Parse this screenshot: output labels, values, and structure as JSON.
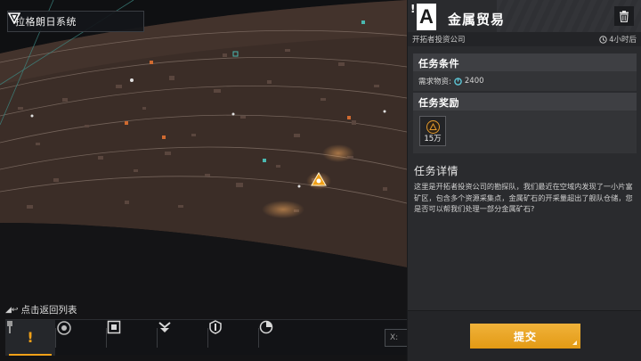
{
  "map": {
    "system_name": "拉格朗日系统",
    "back_label": "点击返回列表",
    "coord_placeholder": "X:"
  },
  "toolbar": {
    "tools": [
      {
        "icon": "mission-alert-icon",
        "active": true
      },
      {
        "icon": "radar-icon",
        "active": false
      },
      {
        "icon": "base-square-icon",
        "active": false
      },
      {
        "icon": "descend-arrow-icon",
        "active": false
      },
      {
        "icon": "shield-marker-icon",
        "active": false
      },
      {
        "icon": "pie-sector-icon",
        "active": false
      }
    ]
  },
  "mission": {
    "alert_mark": "!",
    "rank": "A",
    "title": "金属贸易",
    "issuer": "开拓者投资公司",
    "time_left": "4小时后",
    "conditions_header": "任务条件",
    "requirement_label": "需求物资:",
    "requirement_value": "2400",
    "rewards_header": "任务奖励",
    "reward_amount": "15万",
    "detail_header": "任务详情",
    "detail_text": "这里是开拓者投资公司的勘探队，我们最近在空域内发现了一小片富矿区，包含多个资源采集点，金属矿石的开采量超出了舰队仓储，您是否可以帮我们处理一部分金属矿石?",
    "submit_label": "提交"
  },
  "colors": {
    "accent": "#f0a018",
    "panel_bg": "#2a2b2e",
    "map_terrain": "#3a2c26"
  }
}
